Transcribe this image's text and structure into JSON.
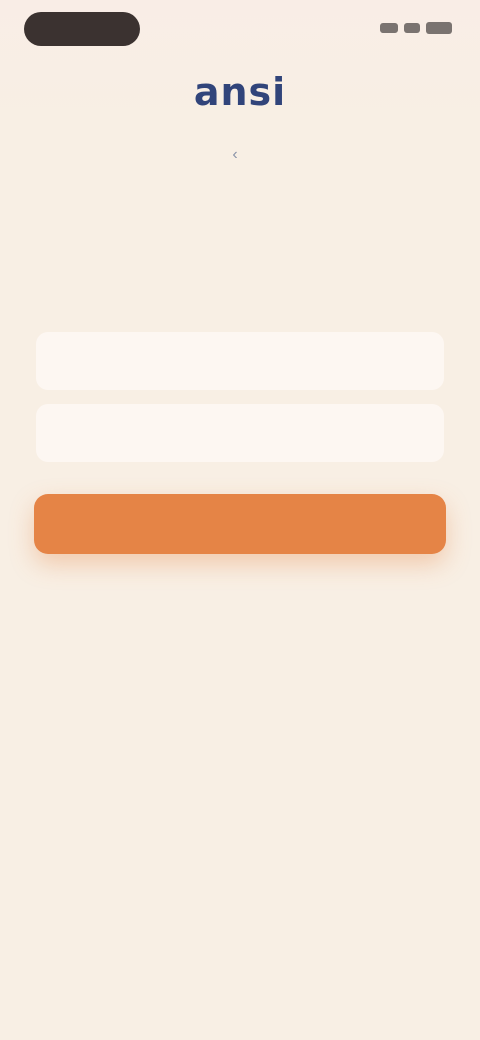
{
  "app": {
    "logo_text": "ansi",
    "subtitle": "",
    "heading": ""
  },
  "form": {
    "field1": {
      "placeholder": "",
      "value": ""
    },
    "field2": {
      "placeholder": "",
      "value": ""
    },
    "submit_label": "",
    "secondary_link": ""
  },
  "footer": {
    "line1": "",
    "line2": ""
  },
  "colors": {
    "background": "#f8efe4",
    "accent": "#e58446",
    "logo": "#31447a"
  },
  "icons": {
    "back": "chevron-left-icon",
    "signal": "cellular-signal-icon",
    "wifi": "wifi-icon",
    "battery": "battery-icon"
  }
}
